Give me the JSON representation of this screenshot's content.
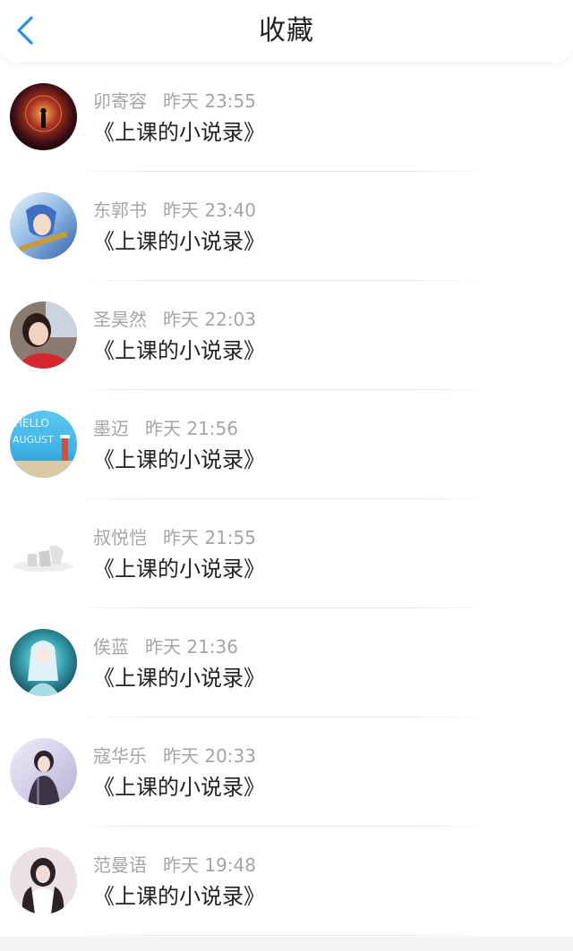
{
  "header": {
    "title": "收藏",
    "back_icon": "chevron-left-icon",
    "accent_color": "#2e8ef0"
  },
  "items": [
    {
      "name": "卯寄容",
      "time": "昨天 23:55",
      "book": "《上课的小说录》"
    },
    {
      "name": "东郭书",
      "time": "昨天 23:40",
      "book": "《上课的小说录》"
    },
    {
      "name": "圣昊然",
      "time": "昨天 22:03",
      "book": "《上课的小说录》"
    },
    {
      "name": "墨迈",
      "time": "昨天 21:56",
      "book": "《上课的小说录》"
    },
    {
      "name": "叔悦恺",
      "time": "昨天 21:55",
      "book": "《上课的小说录》"
    },
    {
      "name": "俟蓝",
      "time": "昨天 21:36",
      "book": "《上课的小说录》"
    },
    {
      "name": "寇华乐",
      "time": "昨天 20:33",
      "book": "《上课的小说录》"
    },
    {
      "name": "范曼语",
      "time": "昨天 19:48",
      "book": "《上课的小说录》"
    }
  ]
}
